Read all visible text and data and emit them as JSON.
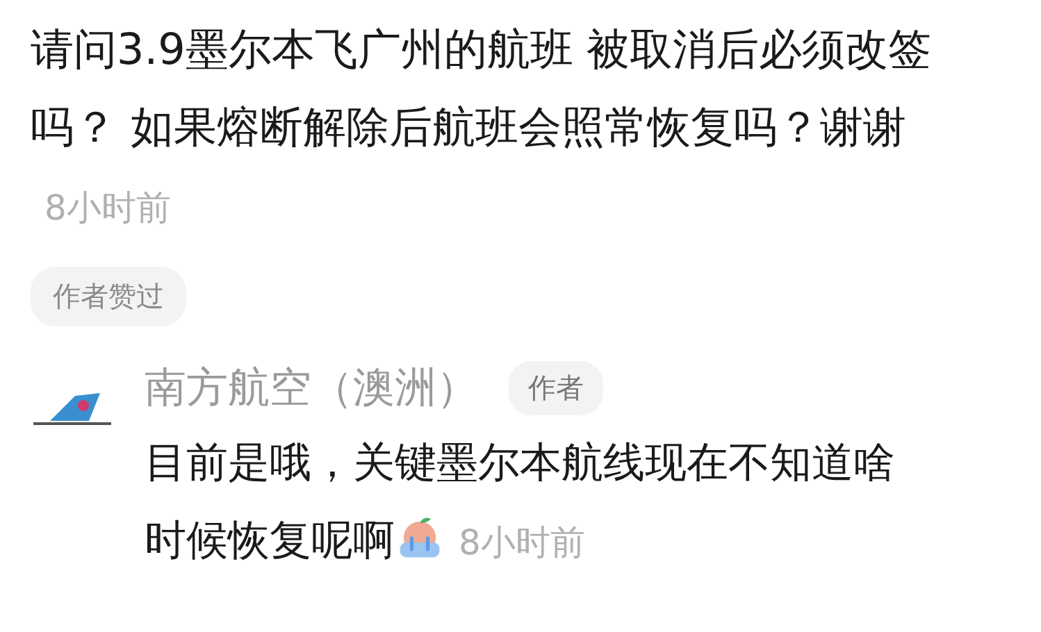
{
  "question": {
    "text": "请问3.9墨尔本飞广州的航班 被取消后必须改签吗？ 如果熔断解除后航班会照常恢复吗？谢谢",
    "time": "8小时前",
    "badge": "作者赞过"
  },
  "reply": {
    "name": "南方航空（澳洲）",
    "tag": "作者",
    "text": "目前是哦，关键墨尔本航线现在不知道啥时候恢复呢啊",
    "time": "8小时前"
  }
}
